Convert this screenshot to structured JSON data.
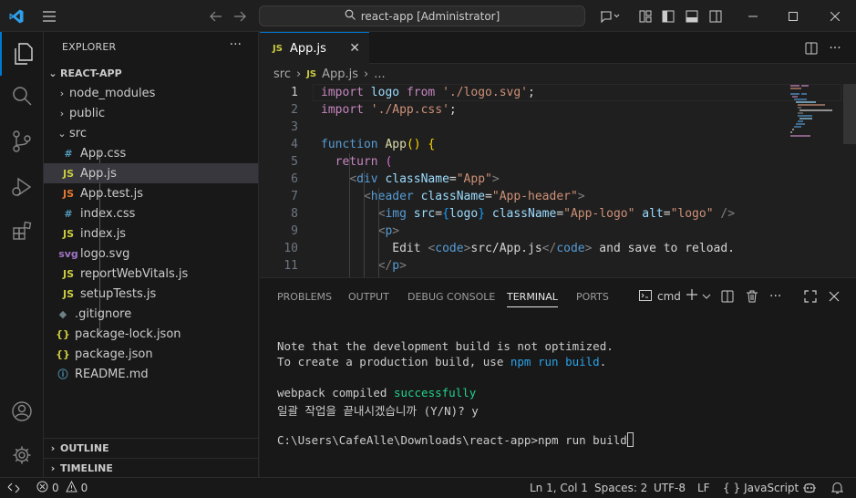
{
  "titlebar": {
    "search_text": "react-app [Administrator]"
  },
  "explorer": {
    "header": "EXPLORER",
    "more": "···",
    "root": "REACT-APP",
    "items": [
      {
        "label": "node_modules",
        "kind": "folder",
        "expanded": false
      },
      {
        "label": "public",
        "kind": "folder",
        "expanded": false
      },
      {
        "label": "src",
        "kind": "folder",
        "expanded": true
      },
      {
        "label": "App.css",
        "kind": "css",
        "icon": "#"
      },
      {
        "label": "App.js",
        "kind": "js",
        "icon": "JS",
        "selected": true
      },
      {
        "label": "App.test.js",
        "kind": "test",
        "icon": "JS"
      },
      {
        "label": "index.css",
        "kind": "css",
        "icon": "#"
      },
      {
        "label": "index.js",
        "kind": "js",
        "icon": "JS"
      },
      {
        "label": "logo.svg",
        "kind": "svg",
        "icon": "svg"
      },
      {
        "label": "reportWebVitals.js",
        "kind": "js",
        "icon": "JS"
      },
      {
        "label": "setupTests.js",
        "kind": "js",
        "icon": "JS"
      },
      {
        "label": ".gitignore",
        "kind": "git",
        "icon": "◆"
      },
      {
        "label": "package-lock.json",
        "kind": "json",
        "icon": "{}"
      },
      {
        "label": "package.json",
        "kind": "json",
        "icon": "{}"
      },
      {
        "label": "README.md",
        "kind": "info",
        "icon": "ⓘ"
      }
    ],
    "outline": "OUTLINE",
    "timeline": "TIMELINE"
  },
  "editor": {
    "tab_icon": "JS",
    "tab_label": "App.js",
    "breadcrumb": {
      "folder": "src",
      "icon": "JS",
      "file": "App.js",
      "tail": "..."
    },
    "line_numbers": [
      "1",
      "2",
      "3",
      "4",
      "5",
      "6",
      "7",
      "8",
      "9",
      "10",
      "11"
    ]
  },
  "panel": {
    "tabs": [
      "PROBLEMS",
      "OUTPUT",
      "DEBUG CONSOLE",
      "TERMINAL",
      "PORTS"
    ],
    "active_tab": "TERMINAL",
    "terminal_name": "cmd",
    "terminal": {
      "l1": "Note that the development build is not optimized.",
      "l2a": "To create a production build, use ",
      "l2b": "npm run build",
      "l2c": ".",
      "l3a": "webpack compiled ",
      "l3b": "successfully",
      "l4": "일괄 작업을 끝내시겠습니까 (Y/N)? y",
      "l5": "C:\\Users\\CafeAlle\\Downloads\\react-app>npm run build"
    }
  },
  "status": {
    "errors": "0",
    "warnings": "0",
    "position": "Ln 1, Col 1",
    "spaces": "Spaces: 2",
    "encoding": "UTF-8",
    "eol": "LF",
    "language": "JavaScript",
    "language_icon": "{ }"
  },
  "colors": {
    "accent": "#0078d4",
    "js_icon": "#cbcb41",
    "css_icon": "#519aba",
    "test_icon": "#e37933",
    "svg_icon": "#a074c4",
    "json_icon": "#cbcb41"
  }
}
